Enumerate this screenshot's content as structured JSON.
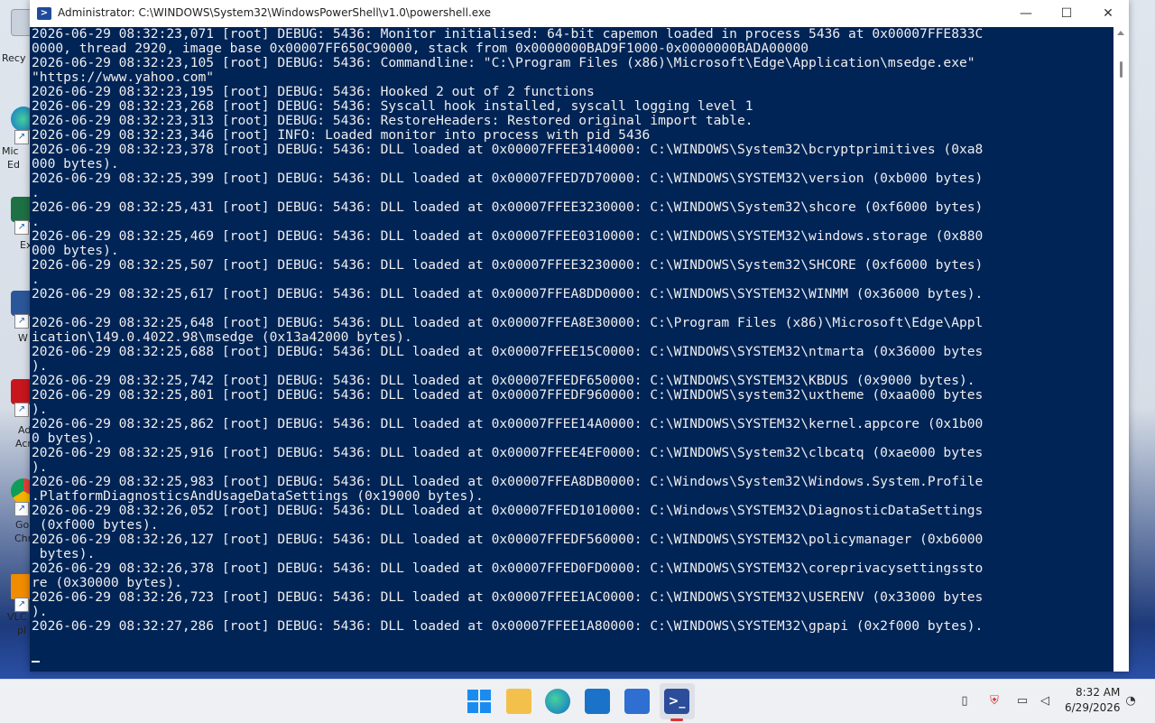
{
  "window": {
    "title": "Administrator: C:\\WINDOWS\\System32\\WindowsPowerShell\\v1.0\\powershell.exe",
    "minimize": "—",
    "maximize": "☐",
    "close": "✕"
  },
  "console": {
    "text": "2026-06-29 08:32:23,071 [root] DEBUG: 5436: Monitor initialised: 64-bit capemon loaded in process 5436 at 0x00007FFE833C\n0000, thread 2920, image base 0x00007FF650C90000, stack from 0x0000000BAD9F1000-0x0000000BADA00000\n2026-06-29 08:32:23,105 [root] DEBUG: 5436: Commandline: \"C:\\Program Files (x86)\\Microsoft\\Edge\\Application\\msedge.exe\"\n\"https://www.yahoo.com\"\n2026-06-29 08:32:23,195 [root] DEBUG: 5436: Hooked 2 out of 2 functions\n2026-06-29 08:32:23,268 [root] DEBUG: 5436: Syscall hook installed, syscall logging level 1\n2026-06-29 08:32:23,313 [root] DEBUG: 5436: RestoreHeaders: Restored original import table.\n2026-06-29 08:32:23,346 [root] INFO: Loaded monitor into process with pid 5436\n2026-06-29 08:32:23,378 [root] DEBUG: 5436: DLL loaded at 0x00007FFEE3140000: C:\\WINDOWS\\System32\\bcryptprimitives (0xa8\n000 bytes).\n2026-06-29 08:32:25,399 [root] DEBUG: 5436: DLL loaded at 0x00007FFED7D70000: C:\\WINDOWS\\SYSTEM32\\version (0xb000 bytes)\n.\n2026-06-29 08:32:25,431 [root] DEBUG: 5436: DLL loaded at 0x00007FFEE3230000: C:\\WINDOWS\\System32\\shcore (0xf6000 bytes)\n.\n2026-06-29 08:32:25,469 [root] DEBUG: 5436: DLL loaded at 0x00007FFEE0310000: C:\\WINDOWS\\SYSTEM32\\windows.storage (0x880\n000 bytes).\n2026-06-29 08:32:25,507 [root] DEBUG: 5436: DLL loaded at 0x00007FFEE3230000: C:\\WINDOWS\\System32\\SHCORE (0xf6000 bytes)\n.\n2026-06-29 08:32:25,617 [root] DEBUG: 5436: DLL loaded at 0x00007FFEA8DD0000: C:\\WINDOWS\\SYSTEM32\\WINMM (0x36000 bytes).\n\n2026-06-29 08:32:25,648 [root] DEBUG: 5436: DLL loaded at 0x00007FFEA8E30000: C:\\Program Files (x86)\\Microsoft\\Edge\\Appl\nication\\149.0.4022.98\\msedge (0x13a42000 bytes).\n2026-06-29 08:32:25,688 [root] DEBUG: 5436: DLL loaded at 0x00007FFEE15C0000: C:\\WINDOWS\\SYSTEM32\\ntmarta (0x36000 bytes\n).\n2026-06-29 08:32:25,742 [root] DEBUG: 5436: DLL loaded at 0x00007FFEDF650000: C:\\WINDOWS\\SYSTEM32\\KBDUS (0x9000 bytes).\n2026-06-29 08:32:25,801 [root] DEBUG: 5436: DLL loaded at 0x00007FFEDF960000: C:\\WINDOWS\\system32\\uxtheme (0xaa000 bytes\n).\n2026-06-29 08:32:25,862 [root] DEBUG: 5436: DLL loaded at 0x00007FFEE14A0000: C:\\WINDOWS\\SYSTEM32\\kernel.appcore (0x1b00\n0 bytes).\n2026-06-29 08:32:25,916 [root] DEBUG: 5436: DLL loaded at 0x00007FFEE4EF0000: C:\\WINDOWS\\System32\\clbcatq (0xae000 bytes\n).\n2026-06-29 08:32:25,983 [root] DEBUG: 5436: DLL loaded at 0x00007FFEA8DB0000: C:\\Windows\\System32\\Windows.System.Profile\n.PlatformDiagnosticsAndUsageDataSettings (0x19000 bytes).\n2026-06-29 08:32:26,052 [root] DEBUG: 5436: DLL loaded at 0x00007FFED1010000: C:\\Windows\\SYSTEM32\\DiagnosticDataSettings\n (0xf000 bytes).\n2026-06-29 08:32:26,127 [root] DEBUG: 5436: DLL loaded at 0x00007FFEDF560000: C:\\WINDOWS\\SYSTEM32\\policymanager (0xb6000\n bytes).\n2026-06-29 08:32:26,378 [root] DEBUG: 5436: DLL loaded at 0x00007FFED0FD0000: C:\\WINDOWS\\SYSTEM32\\coreprivacysettingssto\nre (0x30000 bytes).\n2026-06-29 08:32:26,723 [root] DEBUG: 5436: DLL loaded at 0x00007FFEE1AC0000: C:\\WINDOWS\\SYSTEM32\\USERENV (0x33000 bytes\n).\n2026-06-29 08:32:27,286 [root] DEBUG: 5436: DLL loaded at 0x00007FFEE1A80000: C:\\WINDOWS\\SYSTEM32\\gpapi (0x2f000 bytes)."
  },
  "desktop": {
    "icons": [
      {
        "label": "Recy",
        "icon": "recycle-bin-icon"
      },
      {
        "label": "Mic",
        "label2": "Ed",
        "icon": "edge-shortcut-icon"
      },
      {
        "label": "Ex",
        "icon": "excel-shortcut-icon"
      },
      {
        "label": "W",
        "icon": "word-shortcut-icon"
      },
      {
        "label": "Ad",
        "label2": "Acr",
        "icon": "acrobat-shortcut-icon"
      },
      {
        "label": "Go",
        "label2": "Chr",
        "icon": "chrome-shortcut-icon"
      },
      {
        "label": "VLC",
        "label2": "pl",
        "icon": "vlc-shortcut-icon"
      }
    ]
  },
  "taskbar": {
    "apps": [
      "start-icon",
      "file-explorer-icon",
      "edge-icon",
      "store-icon",
      "outlook-icon",
      "powershell-icon"
    ],
    "tray": [
      "usb-icon",
      "security-icon",
      "network-icon",
      "volume-icon",
      "notification-icon"
    ],
    "time": "8:32 AM",
    "date": "6/29/2026"
  },
  "colors": {
    "console_bg": "#012456",
    "console_fg": "#eeeeee"
  }
}
